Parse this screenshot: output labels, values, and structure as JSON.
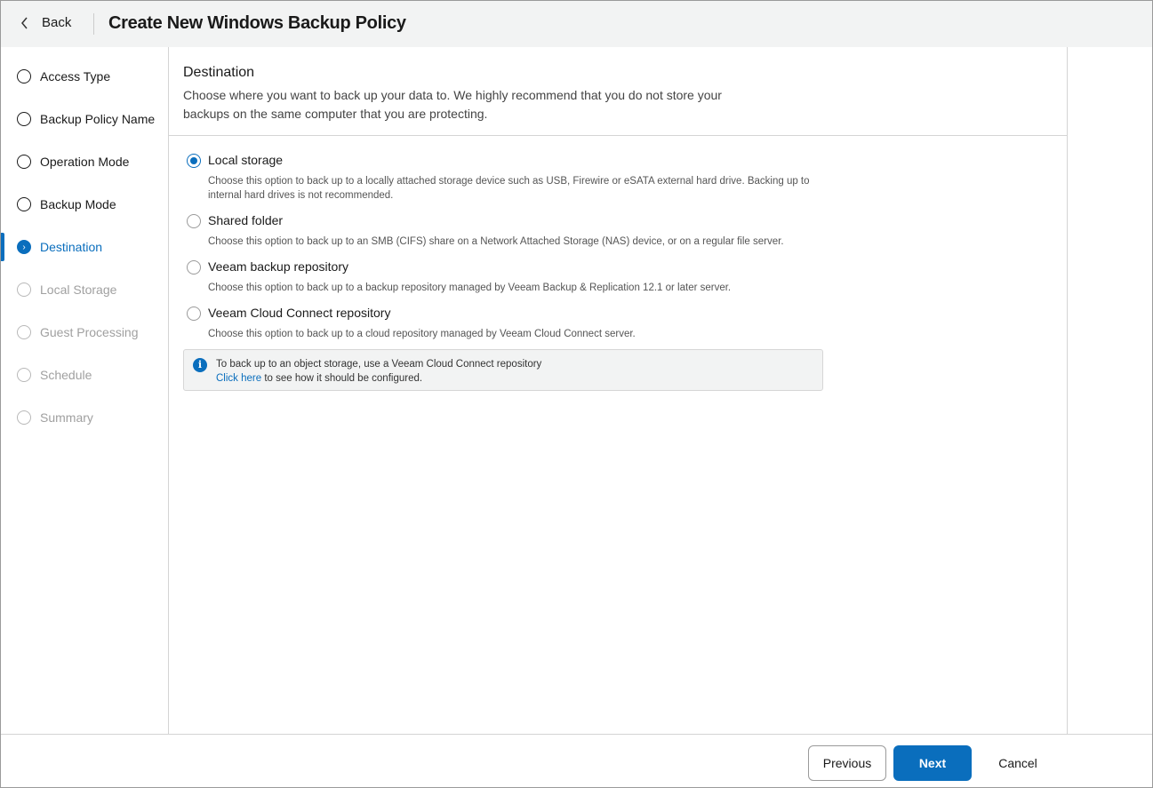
{
  "header": {
    "back_label": "Back",
    "title": "Create New Windows Backup Policy"
  },
  "steps": [
    {
      "label": "Access Type",
      "state": "done"
    },
    {
      "label": "Backup Policy Name",
      "state": "done"
    },
    {
      "label": "Operation Mode",
      "state": "done"
    },
    {
      "label": "Backup Mode",
      "state": "done"
    },
    {
      "label": "Destination",
      "state": "active"
    },
    {
      "label": "Local Storage",
      "state": "disabled"
    },
    {
      "label": "Guest Processing",
      "state": "disabled"
    },
    {
      "label": "Schedule",
      "state": "disabled"
    },
    {
      "label": "Summary",
      "state": "disabled"
    }
  ],
  "section": {
    "title": "Destination",
    "description": "Choose where you want to back up your data to. We highly recommend that you do not store your backups on the same computer that you are protecting."
  },
  "options": [
    {
      "label": "Local storage",
      "description": "Choose this option to back up to a locally attached storage device such as USB, Firewire or eSATA external hard drive. Backing up to internal hard drives is not recommended.",
      "selected": true
    },
    {
      "label": "Shared folder",
      "description": "Choose this option to back up to an SMB (CIFS) share on a Network Attached Storage (NAS) device, or on a regular file server.",
      "selected": false
    },
    {
      "label": "Veeam backup repository",
      "description": "Choose this option to back up to a backup repository managed by Veeam Backup & Replication 12.1 or later server.",
      "selected": false
    },
    {
      "label": "Veeam Cloud Connect repository",
      "description": "Choose this option to back up to a cloud repository managed by Veeam Cloud Connect server.",
      "selected": false
    }
  ],
  "info": {
    "text": "To back up to an object storage, use a Veeam Cloud Connect repository",
    "link": "Click here",
    "link_suffix": " to see how it should be configured."
  },
  "footer": {
    "previous": "Previous",
    "next": "Next",
    "cancel": "Cancel"
  },
  "colors": {
    "accent": "#0a6ebd"
  }
}
